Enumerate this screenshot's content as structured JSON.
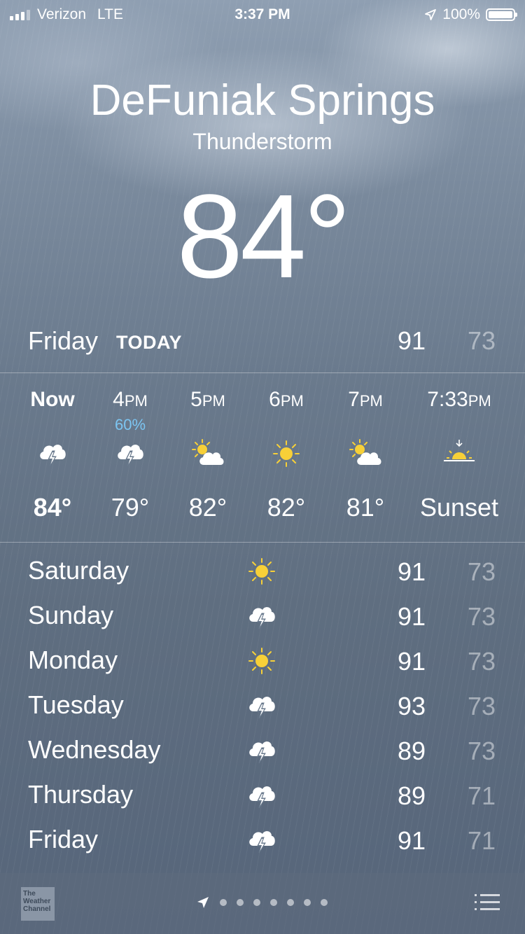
{
  "status_bar": {
    "carrier": "Verizon",
    "network": "LTE",
    "time": "3:37 PM",
    "battery": "100%"
  },
  "location": {
    "city": "DeFuniak Springs",
    "condition": "Thunderstorm",
    "temperature": "84°"
  },
  "today": {
    "day": "Friday",
    "badge": "TODAY",
    "high": "91",
    "low": "73"
  },
  "hourly": [
    {
      "time": "Now",
      "ampm": "",
      "precip": "",
      "icon": "thunderstorm-icon",
      "temp": "84°"
    },
    {
      "time": "4",
      "ampm": "PM",
      "precip": "60%",
      "icon": "thunderstorm-icon",
      "temp": "79°"
    },
    {
      "time": "5",
      "ampm": "PM",
      "precip": "",
      "icon": "partly-sunny-icon",
      "temp": "82°"
    },
    {
      "time": "6",
      "ampm": "PM",
      "precip": "",
      "icon": "sunny-icon",
      "temp": "82°"
    },
    {
      "time": "7",
      "ampm": "PM",
      "precip": "",
      "icon": "partly-sunny-icon",
      "temp": "81°"
    },
    {
      "time": "7:33",
      "ampm": "PM",
      "precip": "",
      "icon": "sunset-icon",
      "temp": "Sunset"
    }
  ],
  "daily": [
    {
      "day": "Saturday",
      "icon": "sunny-icon",
      "high": "91",
      "low": "73"
    },
    {
      "day": "Sunday",
      "icon": "thunderstorm-icon",
      "high": "91",
      "low": "73"
    },
    {
      "day": "Monday",
      "icon": "sunny-icon",
      "high": "91",
      "low": "73"
    },
    {
      "day": "Tuesday",
      "icon": "thunderstorm-icon",
      "high": "93",
      "low": "73"
    },
    {
      "day": "Wednesday",
      "icon": "thunderstorm-icon",
      "high": "89",
      "low": "73"
    },
    {
      "day": "Thursday",
      "icon": "thunderstorm-icon",
      "high": "89",
      "low": "71"
    },
    {
      "day": "Friday",
      "icon": "thunderstorm-icon",
      "high": "91",
      "low": "71"
    }
  ],
  "bottom_bar": {
    "logo_text": "The Weather Channel",
    "page_count": 7
  },
  "colors": {
    "sun": "#f7d038",
    "precip": "#7cc5f2"
  }
}
